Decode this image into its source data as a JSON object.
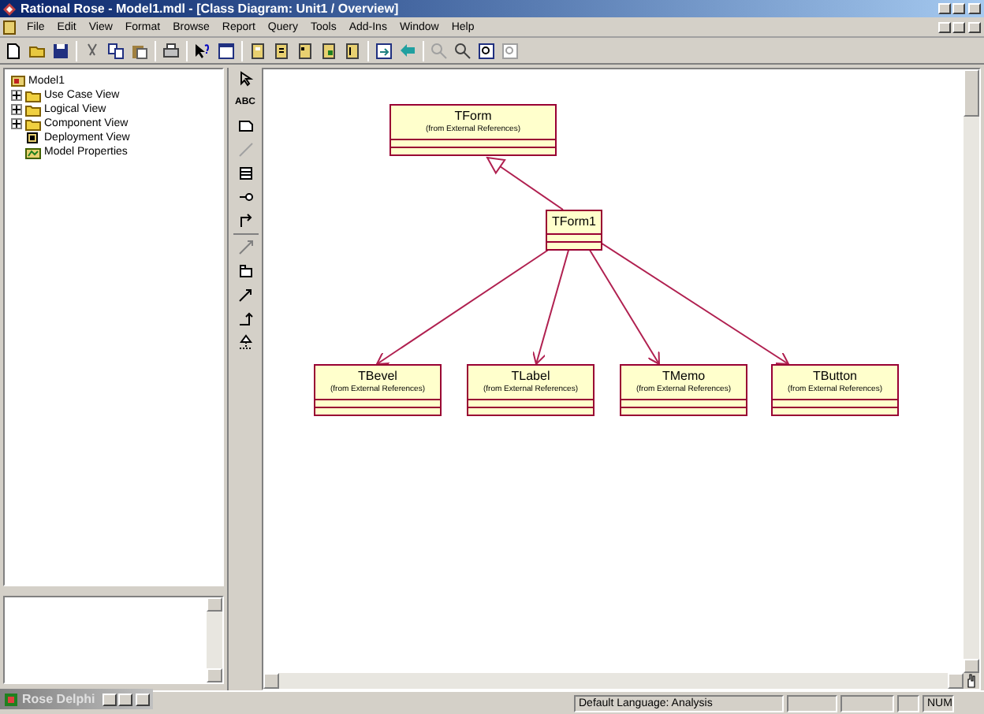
{
  "window": {
    "title": "Rational Rose - Model1.mdl - [Class Diagram: Unit1 / Overview]"
  },
  "menu": [
    "File",
    "Edit",
    "View",
    "Format",
    "Browse",
    "Report",
    "Query",
    "Tools",
    "Add-Ins",
    "Window",
    "Help"
  ],
  "browser": {
    "root": "Model1",
    "children": [
      {
        "label": "Use Case View",
        "kind": "folder",
        "expanded": false
      },
      {
        "label": "Logical View",
        "kind": "folder",
        "expanded": false
      },
      {
        "label": "Component View",
        "kind": "folder",
        "expanded": false
      },
      {
        "label": "Deployment View",
        "kind": "deployment"
      },
      {
        "label": "Model Properties",
        "kind": "properties"
      }
    ]
  },
  "toolbox": {
    "text_tool": "ABC"
  },
  "diagram": {
    "classes": [
      {
        "name": "TForm",
        "subtitle": "(from External References)"
      },
      {
        "name": "TForm1"
      },
      {
        "name": "TBevel",
        "subtitle": "(from External References)"
      },
      {
        "name": "TLabel",
        "subtitle": "(from External References)"
      },
      {
        "name": "TMemo",
        "subtitle": "(from External References)"
      },
      {
        "name": "TButton",
        "subtitle": "(from External References)"
      }
    ]
  },
  "minimized_window": {
    "title": "Rose Delphi"
  },
  "status_bar": {
    "language": "Default Language: Analysis",
    "num": "NUM"
  }
}
